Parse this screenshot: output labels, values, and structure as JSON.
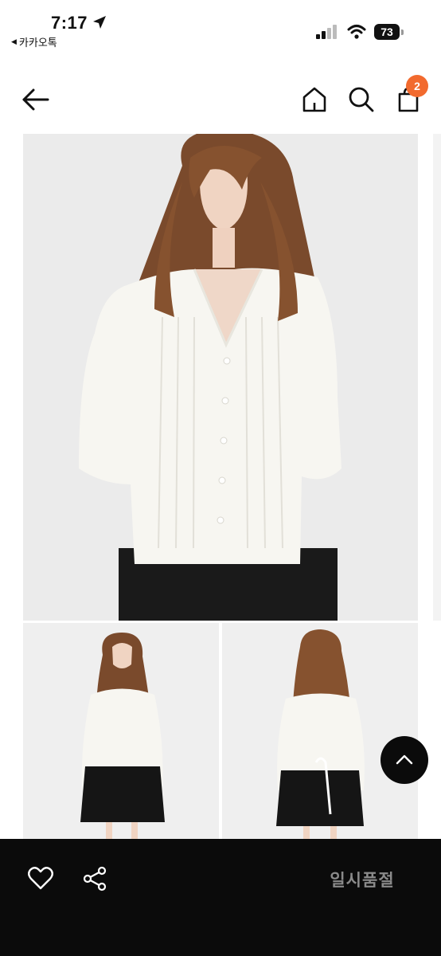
{
  "status_bar": {
    "time": "7:17",
    "back_app_label": "카카오톡",
    "battery_level": "73",
    "icons": [
      "location-arrow-icon",
      "signal-icon",
      "wifi-icon",
      "battery-icon"
    ]
  },
  "header": {
    "icons": [
      "arrow-left-icon",
      "home-icon",
      "search-icon",
      "shopping-bag-icon"
    ],
    "cart_count": "2"
  },
  "product_images": {
    "main": "model-front-closeup",
    "thumbnails": [
      "model-front-full",
      "model-back-full"
    ]
  },
  "bottom_bar": {
    "icons": [
      "heart-icon",
      "share-icon"
    ],
    "status_label": "일시품절"
  },
  "colors": {
    "badge": "#f26a2e",
    "bottom_bar": "#0b0b0b",
    "soldout_text": "#8a8a8a"
  }
}
